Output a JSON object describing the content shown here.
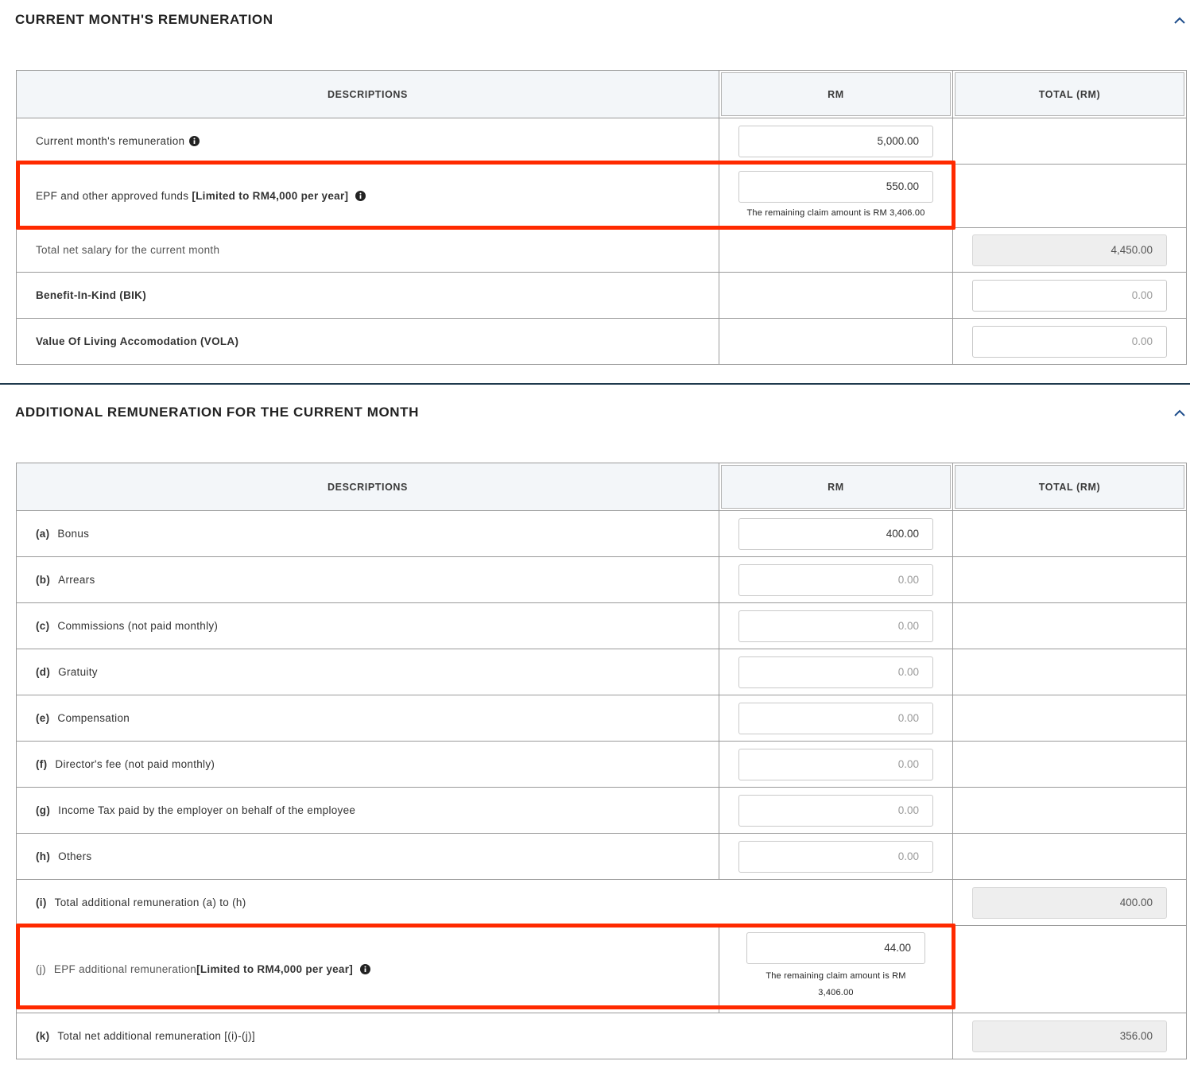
{
  "section1": {
    "title": "CURRENT MONTH'S REMUNERATION",
    "headers": {
      "descriptions": "DESCRIPTIONS",
      "rm": "RM",
      "total": "TOTAL (RM)"
    },
    "rows": {
      "current": {
        "label": "Current month's remuneration",
        "value": "5,000.00"
      },
      "epf": {
        "label": "EPF and other approved funds ",
        "label_bold": "[Limited to RM4,000 per year]",
        "value": "550.00",
        "hint": "The remaining claim amount is RM 3,406.00"
      },
      "net": {
        "label": "Total net salary for the current month",
        "total": "4,450.00"
      },
      "bik": {
        "label": "Benefit-In-Kind (BIK)",
        "total": "0.00"
      },
      "vola": {
        "label": "Value Of Living Accomodation (VOLA)",
        "total": "0.00"
      }
    }
  },
  "section2": {
    "title": "ADDITIONAL REMUNERATION FOR THE CURRENT MONTH",
    "headers": {
      "descriptions": "DESCRIPTIONS",
      "rm": "RM",
      "total": "TOTAL (RM)"
    },
    "items": [
      {
        "key": "(a)",
        "label": "Bonus",
        "value": "400.00"
      },
      {
        "key": "(b)",
        "label": "Arrears",
        "value": "0.00"
      },
      {
        "key": "(c)",
        "label": "Commissions (not paid monthly)",
        "value": "0.00"
      },
      {
        "key": "(d)",
        "label": "Gratuity",
        "value": "0.00"
      },
      {
        "key": "(e)",
        "label": "Compensation",
        "value": "0.00"
      },
      {
        "key": "(f)",
        "label": "Director's fee (not paid monthly)",
        "value": "0.00"
      },
      {
        "key": "(g)",
        "label": "Income Tax paid by the employer on behalf of the employee",
        "value": "0.00"
      },
      {
        "key": "(h)",
        "label": "Others",
        "value": "0.00"
      }
    ],
    "total_i": {
      "key": "(i)",
      "label": "Total additional remuneration (a) to (h)",
      "total": "400.00"
    },
    "epf_j": {
      "key": "(j)",
      "label": "EPF additional remuneration",
      "label_bold": "[Limited to RM4,000 per year]",
      "value": "44.00",
      "hint_line1": "The remaining claim amount is RM",
      "hint_line2": "3,406.00"
    },
    "net_k": {
      "key": "(k)",
      "label": "Total net additional remuneration [(i)-(j)]",
      "total": "356.00"
    }
  },
  "icons": {
    "collapse": "chevron-up-icon",
    "info": "info-circle-icon"
  },
  "colors": {
    "highlight": "#ff2a00",
    "header_bg": "#f3f6f9",
    "divider": "#1f3a4d"
  }
}
